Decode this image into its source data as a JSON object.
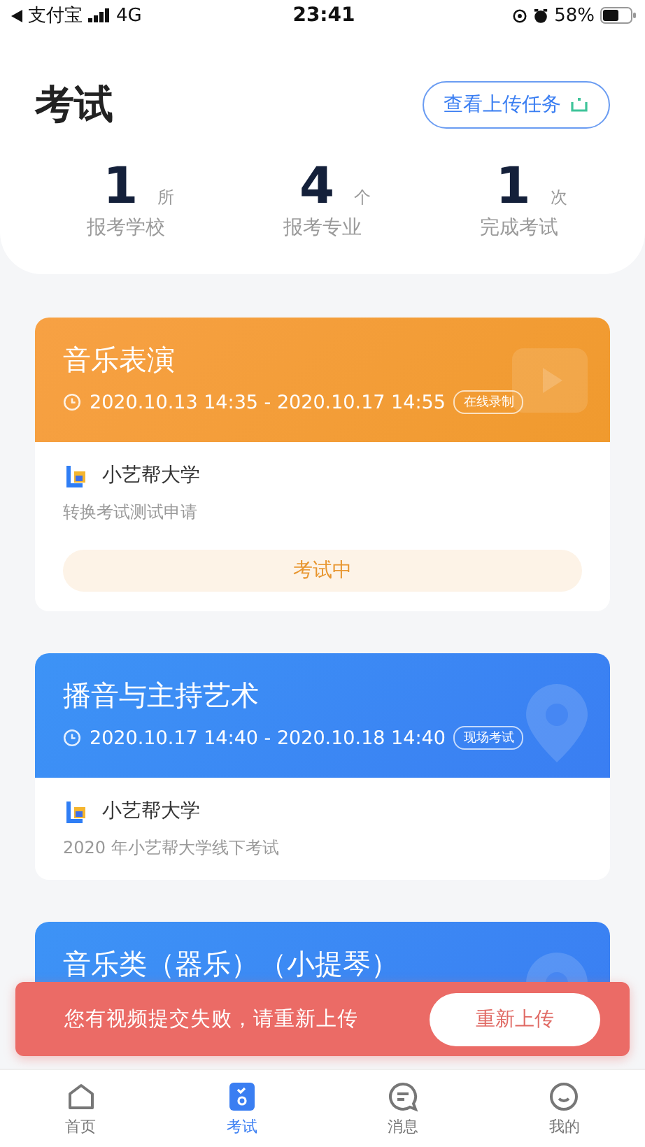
{
  "status_bar": {
    "carrier": "支付宝",
    "network": "4G",
    "time": "23:41",
    "battery": "58%"
  },
  "header": {
    "title": "考试",
    "upload_button": "查看上传任务"
  },
  "stats": [
    {
      "value": "1",
      "unit": "所",
      "label": "报考学校"
    },
    {
      "value": "4",
      "unit": "个",
      "label": "报考专业"
    },
    {
      "value": "1",
      "unit": "次",
      "label": "完成考试"
    }
  ],
  "exams": [
    {
      "kind": "online",
      "title": "音乐表演",
      "time": "2020.10.13 14:35 - 2020.10.17 14:55",
      "tag": "在线录制",
      "school": "小艺帮大学",
      "description": "转换考试测试申请",
      "status": "考试中"
    },
    {
      "kind": "onsite",
      "title": "播音与主持艺术",
      "time": "2020.10.17 14:40 - 2020.10.18 14:40",
      "tag": "现场考试",
      "school": "小艺帮大学",
      "description": "2020 年小艺帮大学线下考试"
    },
    {
      "kind": "onsite",
      "title": "音乐类（器乐）（小提琴）"
    }
  ],
  "toast": {
    "message": "您有视频提交失败，请重新上传",
    "button": "重新上传"
  },
  "tabs": [
    {
      "label": "首页",
      "kind": "home",
      "selected": false
    },
    {
      "label": "考试",
      "kind": "exam",
      "selected": true
    },
    {
      "label": "消息",
      "kind": "message",
      "selected": false
    },
    {
      "label": "我的",
      "kind": "profile",
      "selected": false
    }
  ]
}
